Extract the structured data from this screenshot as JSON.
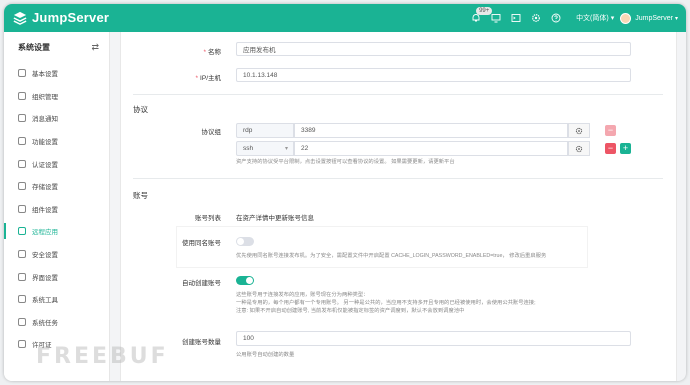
{
  "app": {
    "brand": "JumpServer",
    "brand_color": "#1ab394"
  },
  "topbar": {
    "badge": "99+",
    "language": "中文(简体)",
    "user": "JumpServer",
    "icons": [
      "bell-icon",
      "desktop-icon",
      "terminal-icon",
      "settings-icon",
      "question-icon"
    ]
  },
  "sidebar": {
    "title": "系统设置",
    "items": [
      {
        "label": "基本设置"
      },
      {
        "label": "组织管理"
      },
      {
        "label": "消息通知"
      },
      {
        "label": "功能设置"
      },
      {
        "label": "认证设置"
      },
      {
        "label": "存储设置"
      },
      {
        "label": "组件设置"
      },
      {
        "label": "远程应用",
        "active": true
      },
      {
        "label": "安全设置"
      },
      {
        "label": "界面设置"
      },
      {
        "label": "系统工具"
      },
      {
        "label": "系统任务"
      },
      {
        "label": "许可证"
      }
    ]
  },
  "form": {
    "name_label": "名称",
    "name_value": "应用发布机",
    "ip_label": "IP/主机",
    "ip_value": "10.1.13.148",
    "protocol_section": "协议",
    "protocol_group_label": "协议组",
    "protocols": [
      {
        "name": "rdp",
        "port": "3389"
      },
      {
        "name": "ssh",
        "port": "22"
      }
    ],
    "protocol_help": "资产支持的协议受平台限制，点击设置按钮可以查看协议的设置。 如果需要更新，请更新平台",
    "account_section": "账号",
    "account_list_label": "账号列表",
    "account_list_value": "在资产详情中更新账号信息",
    "same_name_label": "使用同名账号",
    "same_name_help": "优先使用同名账号连接发布机。为了安全，需配置文件中开启配置 CACHE_LOGIN_PASSWORD_ENABLED=true， 修改后重启服务",
    "auto_create_label": "自动创建账号",
    "auto_create_help": [
      "这些账号用于连接发布的应用，账号现在分为两种类型：",
      "一种是专用的，每个用户都有一个专用账号。 另一种是公共的，当应用不支持多开且专用的已经被使用时，会使用公共账号连接;",
      "注意: 如果不开启自动创建账号, 当前发布机仅能被指定标签的资产调度到，默认不会放到调度池中"
    ],
    "auto_create_count_label": "创建账号数量",
    "auto_create_count_value": "100",
    "auto_create_count_help": "公用账号自动创建的数量"
  },
  "watermark": "FREEBUF"
}
